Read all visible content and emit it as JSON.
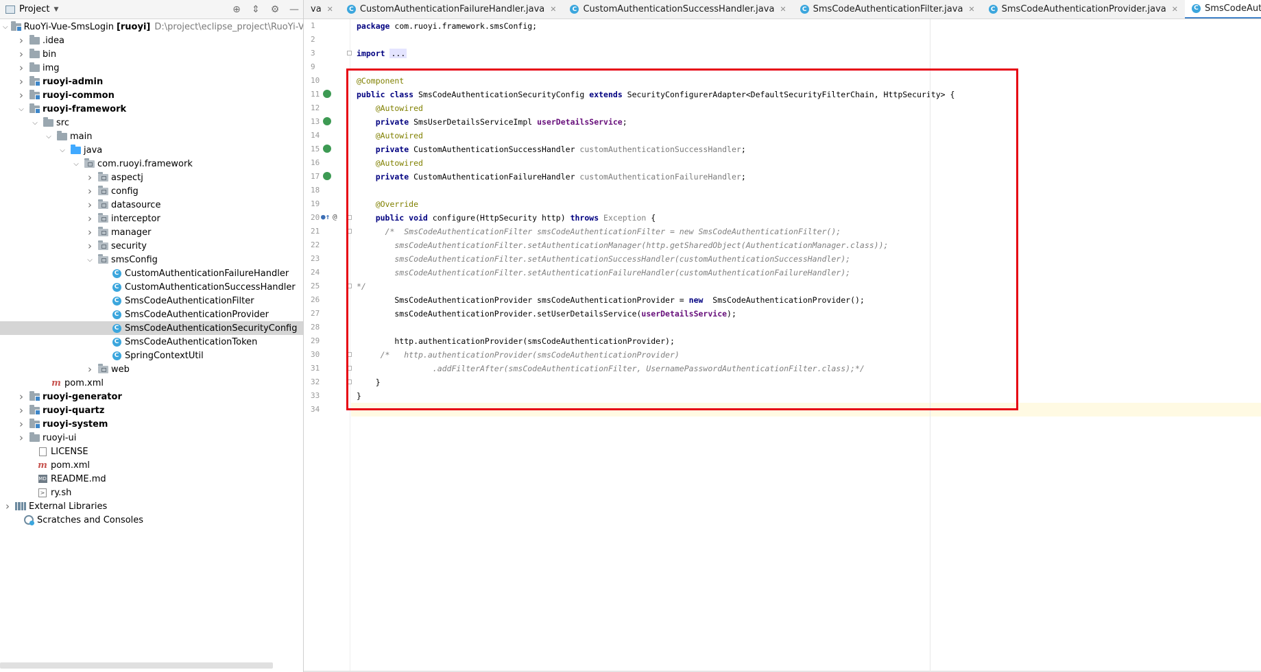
{
  "project_panel": {
    "title": "Project",
    "tree": [
      {
        "level": 0,
        "arrow": "down",
        "icon": "module-folder",
        "label": "RuoYi-Vue-SmsLogin",
        "bold_suffix": "[ruoyi]",
        "path": "D:\\project\\eclipse_project\\RuoYi-Vue-Sr"
      },
      {
        "level": 1,
        "arrow": "right",
        "icon": "folder",
        "label": ".idea"
      },
      {
        "level": 1,
        "arrow": "right",
        "icon": "folder",
        "label": "bin"
      },
      {
        "level": 1,
        "arrow": "right",
        "icon": "folder",
        "label": "img"
      },
      {
        "level": 1,
        "arrow": "right",
        "icon": "module-folder",
        "label": "ruoyi-admin",
        "bold": true
      },
      {
        "level": 1,
        "arrow": "right",
        "icon": "module-folder",
        "label": "ruoyi-common",
        "bold": true
      },
      {
        "level": 1,
        "arrow": "down",
        "icon": "module-folder",
        "label": "ruoyi-framework",
        "bold": true
      },
      {
        "level": 2,
        "arrow": "down",
        "icon": "folder",
        "label": "src"
      },
      {
        "level": 3,
        "arrow": "down",
        "icon": "folder",
        "label": "main"
      },
      {
        "level": 4,
        "arrow": "down",
        "icon": "blue-folder",
        "label": "java"
      },
      {
        "level": 5,
        "arrow": "down",
        "icon": "package",
        "label": "com.ruoyi.framework"
      },
      {
        "level": 6,
        "arrow": "right",
        "icon": "package",
        "label": "aspectj"
      },
      {
        "level": 6,
        "arrow": "right",
        "icon": "package",
        "label": "config"
      },
      {
        "level": 6,
        "arrow": "right",
        "icon": "package",
        "label": "datasource"
      },
      {
        "level": 6,
        "arrow": "right",
        "icon": "package",
        "label": "interceptor"
      },
      {
        "level": 6,
        "arrow": "right",
        "icon": "package",
        "label": "manager"
      },
      {
        "level": 6,
        "arrow": "right",
        "icon": "package",
        "label": "security"
      },
      {
        "level": 6,
        "arrow": "down",
        "icon": "package",
        "label": "smsConfig"
      },
      {
        "level": 7,
        "arrow": "none",
        "icon": "class",
        "label": "CustomAuthenticationFailureHandler"
      },
      {
        "level": 7,
        "arrow": "none",
        "icon": "class",
        "label": "CustomAuthenticationSuccessHandler"
      },
      {
        "level": 7,
        "arrow": "none",
        "icon": "class",
        "label": "SmsCodeAuthenticationFilter"
      },
      {
        "level": 7,
        "arrow": "none",
        "icon": "class",
        "label": "SmsCodeAuthenticationProvider"
      },
      {
        "level": 7,
        "arrow": "none",
        "icon": "class",
        "label": "SmsCodeAuthenticationSecurityConfig",
        "selected": true
      },
      {
        "level": 7,
        "arrow": "none",
        "icon": "class",
        "label": "SmsCodeAuthenticationToken"
      },
      {
        "level": 7,
        "arrow": "none",
        "icon": "class",
        "label": "SpringContextUtil"
      },
      {
        "level": 6,
        "arrow": "right",
        "icon": "package",
        "label": "web"
      },
      {
        "level": 2.6,
        "arrow": "none",
        "icon": "maven",
        "label": "pom.xml"
      },
      {
        "level": 1,
        "arrow": "right",
        "icon": "module-folder",
        "label": "ruoyi-generator",
        "bold": true
      },
      {
        "level": 1,
        "arrow": "right",
        "icon": "module-folder",
        "label": "ruoyi-quartz",
        "bold": true
      },
      {
        "level": 1,
        "arrow": "right",
        "icon": "module-folder",
        "label": "ruoyi-system",
        "bold": true
      },
      {
        "level": 1,
        "arrow": "right",
        "icon": "folder",
        "label": "ruoyi-ui"
      },
      {
        "level": 1.6,
        "arrow": "none",
        "icon": "file",
        "label": "LICENSE"
      },
      {
        "level": 1.6,
        "arrow": "none",
        "icon": "maven",
        "label": "pom.xml"
      },
      {
        "level": 1.6,
        "arrow": "none",
        "icon": "markdown",
        "label": "README.md"
      },
      {
        "level": 1.6,
        "arrow": "none",
        "icon": "shell",
        "label": "ry.sh"
      },
      {
        "level": 0,
        "arrow": "right",
        "icon": "library",
        "label": "External Libraries"
      },
      {
        "level": 0.6,
        "arrow": "none",
        "icon": "scratch",
        "label": "Scratches and Consoles"
      }
    ]
  },
  "tabs": [
    {
      "label": "va",
      "icon": "none",
      "active": false
    },
    {
      "label": "CustomAuthenticationFailureHandler.java",
      "icon": "class",
      "active": false
    },
    {
      "label": "CustomAuthenticationSuccessHandler.java",
      "icon": "class",
      "active": false
    },
    {
      "label": "SmsCodeAuthenticationFilter.java",
      "icon": "class",
      "active": false
    },
    {
      "label": "SmsCodeAuthenticationProvider.java",
      "icon": "class",
      "active": false
    },
    {
      "label": "SmsCodeAuthenticationSecurityConfig.java",
      "icon": "class",
      "active": true
    }
  ],
  "gutter": [
    {
      "n": "1"
    },
    {
      "n": "2"
    },
    {
      "n": "3",
      "fold": true
    },
    {
      "n": "9"
    },
    {
      "n": "10"
    },
    {
      "n": "11",
      "mark": "bean"
    },
    {
      "n": "12"
    },
    {
      "n": "13",
      "mark": "bean"
    },
    {
      "n": "14"
    },
    {
      "n": "15",
      "mark": "bean"
    },
    {
      "n": "16"
    },
    {
      "n": "17",
      "mark": "bean"
    },
    {
      "n": "18"
    },
    {
      "n": "19"
    },
    {
      "n": "20",
      "mark": "override",
      "fold": true
    },
    {
      "n": "21",
      "fold": true
    },
    {
      "n": "22"
    },
    {
      "n": "23"
    },
    {
      "n": "24"
    },
    {
      "n": "25",
      "fold": true
    },
    {
      "n": "26"
    },
    {
      "n": "27"
    },
    {
      "n": "28"
    },
    {
      "n": "29"
    },
    {
      "n": "30",
      "fold": true
    },
    {
      "n": "31",
      "fold": true
    },
    {
      "n": "32",
      "fold": true
    },
    {
      "n": "33"
    },
    {
      "n": "34"
    }
  ],
  "code": [
    [
      {
        "t": "package",
        "c": "kw"
      },
      {
        "t": " com.ruoyi.framework.smsConfig;",
        "c": "txt"
      }
    ],
    [],
    [
      {
        "t": "import",
        "c": "kw"
      },
      {
        "t": " ",
        "c": "txt"
      },
      {
        "t": "...",
        "c": "foldtext"
      }
    ],
    [],
    [
      {
        "t": "@Component",
        "c": "ann"
      }
    ],
    [
      {
        "t": "public class",
        "c": "kw"
      },
      {
        "t": " SmsCodeAuthenticationSecurityConfig ",
        "c": "txt"
      },
      {
        "t": "extends",
        "c": "kw"
      },
      {
        "t": " SecurityConfigurerAdapter<DefaultSecurityFilterChain, HttpSecurity> {",
        "c": "txt"
      }
    ],
    [
      {
        "t": "    @Autowired",
        "c": "ann"
      }
    ],
    [
      {
        "t": "    private",
        "c": "kw"
      },
      {
        "t": " SmsUserDetailsServiceImpl ",
        "c": "txt"
      },
      {
        "t": "userDetailsService",
        "c": "fld"
      },
      {
        "t": ";",
        "c": "txt"
      }
    ],
    [
      {
        "t": "    @Autowired",
        "c": "ann"
      }
    ],
    [
      {
        "t": "    private",
        "c": "kw"
      },
      {
        "t": " CustomAuthenticationSuccessHandler ",
        "c": "txt"
      },
      {
        "t": "customAuthenticationSuccessHandler",
        "c": "fldg"
      },
      {
        "t": ";",
        "c": "txt"
      }
    ],
    [
      {
        "t": "    @Autowired",
        "c": "ann"
      }
    ],
    [
      {
        "t": "    private",
        "c": "kw"
      },
      {
        "t": " CustomAuthenticationFailureHandler ",
        "c": "txt"
      },
      {
        "t": "customAuthenticationFailureHandler",
        "c": "fldg"
      },
      {
        "t": ";",
        "c": "txt"
      }
    ],
    [],
    [
      {
        "t": "    @Override",
        "c": "ann"
      }
    ],
    [
      {
        "t": "    public void",
        "c": "kw"
      },
      {
        "t": " configure(HttpSecurity http) ",
        "c": "txt"
      },
      {
        "t": "throws",
        "c": "kw"
      },
      {
        "t": " Exception",
        "c": "gray"
      },
      {
        "t": " {",
        "c": "txt"
      }
    ],
    [
      {
        "t": "      /*  SmsCodeAuthenticationFilter smsCodeAuthenticationFilter = new SmsCodeAuthenticationFilter();",
        "c": "cmt"
      }
    ],
    [
      {
        "t": "        smsCodeAuthenticationFilter.setAuthenticationManager(http.getSharedObject(AuthenticationManager.class));",
        "c": "cmt"
      }
    ],
    [
      {
        "t": "        smsCodeAuthenticationFilter.setAuthenticationSuccessHandler(customAuthenticationSuccessHandler);",
        "c": "cmt"
      }
    ],
    [
      {
        "t": "        smsCodeAuthenticationFilter.setAuthenticationFailureHandler(customAuthenticationFailureHandler);",
        "c": "cmt"
      }
    ],
    [
      {
        "t": "*/",
        "c": "cmt"
      }
    ],
    [
      {
        "t": "        SmsCodeAuthenticationProvider smsCodeAuthenticationProvider = ",
        "c": "txt"
      },
      {
        "t": "new",
        "c": "kw"
      },
      {
        "t": "  SmsCodeAuthenticationProvider();",
        "c": "txt"
      }
    ],
    [
      {
        "t": "        smsCodeAuthenticationProvider.setUserDetailsService(",
        "c": "txt"
      },
      {
        "t": "userDetailsService",
        "c": "fld"
      },
      {
        "t": ");",
        "c": "txt"
      }
    ],
    [],
    [
      {
        "t": "        http.authenticationProvider(smsCodeAuthenticationProvider);",
        "c": "txt"
      }
    ],
    [
      {
        "t": "     /*   http.authenticationProvider(smsCodeAuthenticationProvider)",
        "c": "cmt"
      }
    ],
    [
      {
        "t": "                .addFilterAfter(smsCodeAuthenticationFilter, UsernamePasswordAuthenticationFilter.class);*/",
        "c": "cmt"
      }
    ],
    [
      {
        "t": "    }",
        "c": "txt"
      }
    ],
    [
      {
        "t": "}",
        "c": "txt"
      }
    ],
    []
  ],
  "current_line_index": 28
}
